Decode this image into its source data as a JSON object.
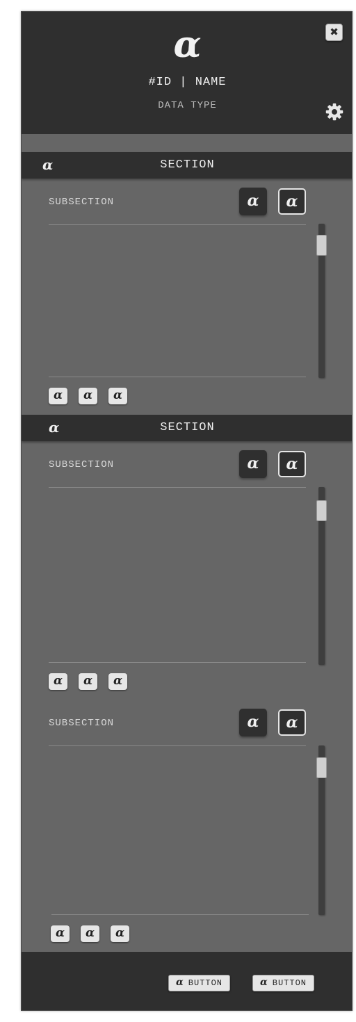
{
  "header": {
    "logo_glyph": "α",
    "title": "#ID | NAME",
    "subtitle": "DATA TYPE",
    "close_glyph": "✖",
    "settings_icon": "gear-icon"
  },
  "sections": [
    {
      "icon": "α",
      "title": "SECTION",
      "subsections": [
        {
          "label": "SUBSECTION",
          "buttons": [
            "α",
            "α"
          ],
          "actions": [
            "α",
            "α",
            "α"
          ]
        }
      ]
    },
    {
      "icon": "α",
      "title": "SECTION",
      "subsections": [
        {
          "label": "SUBSECTION",
          "buttons": [
            "α",
            "α"
          ],
          "actions": [
            "α",
            "α",
            "α"
          ]
        },
        {
          "label": "SUBSECTION",
          "buttons": [
            "α",
            "α"
          ],
          "actions": [
            "α",
            "α",
            "α"
          ]
        }
      ]
    }
  ],
  "footer": {
    "buttons": [
      {
        "icon": "α",
        "label": "BUTTON"
      },
      {
        "icon": "α",
        "label": "BUTTON"
      }
    ]
  },
  "colors": {
    "panel_bg": "#666666",
    "bar_bg": "#2f2f2f",
    "text_light": "#f0f0f0",
    "button_light": "#e6e6e6"
  }
}
